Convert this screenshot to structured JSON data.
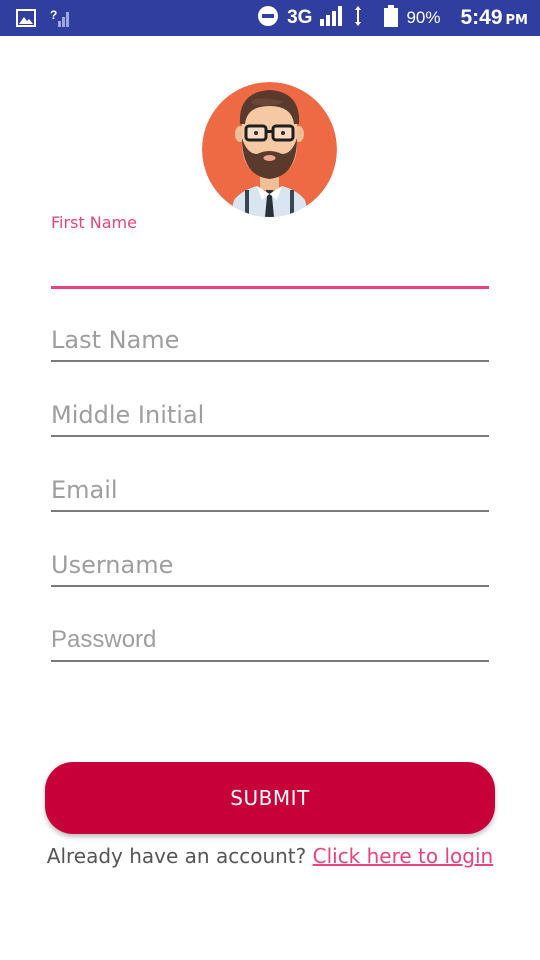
{
  "status_bar": {
    "network": "3G",
    "battery": "90%",
    "time": "5:49",
    "ampm": "PM",
    "icons": [
      "image-icon",
      "no-sim-signal-icon",
      "do-not-disturb-icon",
      "signal-bars-icon",
      "data-arrows-icon",
      "battery-icon"
    ]
  },
  "avatar": {
    "icon": "bearded-man-avatar-icon",
    "bg_color": "#ee6a45"
  },
  "form": {
    "first_name_label": "First Name",
    "first_name_value": "",
    "last_name_placeholder": "Last Name",
    "middle_initial_placeholder": "Middle Initial",
    "email_placeholder": "Email",
    "username_placeholder": "Username",
    "password_placeholder": "Password"
  },
  "submit_label": "SUBMIT",
  "login": {
    "prompt": "Already have an account?",
    "link": "Click here to login"
  },
  "colors": {
    "status_bar": "#303f9f",
    "accent": "#e8437a",
    "button": "#c8003a"
  }
}
